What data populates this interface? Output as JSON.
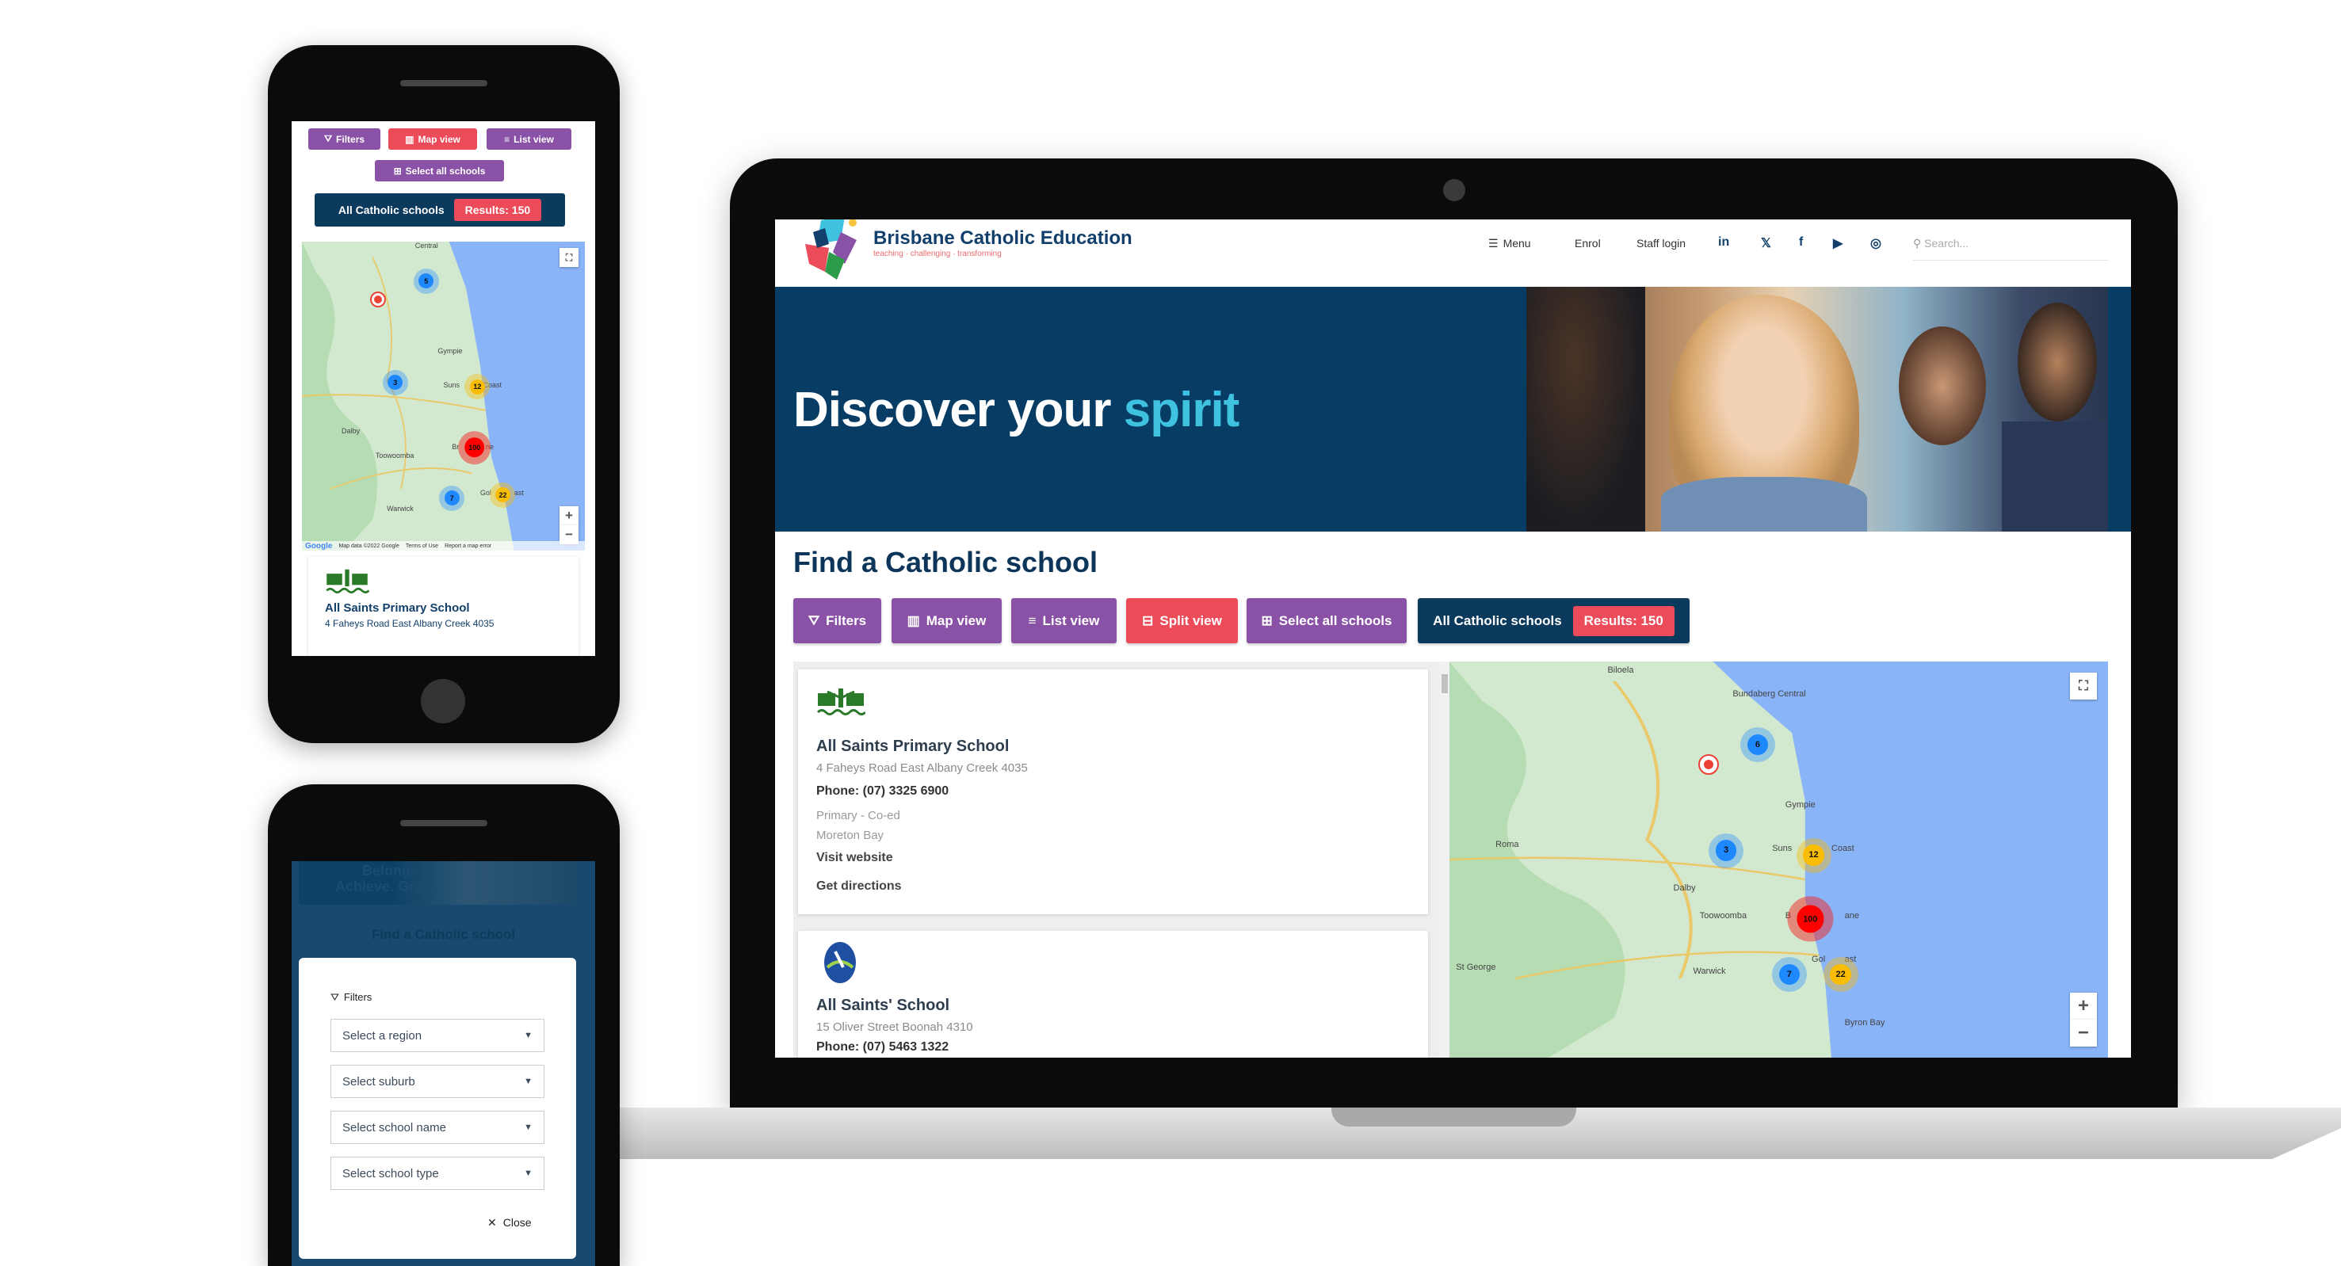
{
  "laptop": {
    "header": {
      "brand": "Brisbane Catholic Education",
      "tagline": "teaching · challenging · transforming",
      "nav": [
        {
          "label": "Menu",
          "icon": "hamburger-icon"
        },
        {
          "label": "Enrol"
        },
        {
          "label": "Staff login"
        }
      ],
      "social": [
        "in",
        "𝕏",
        "f",
        "▶",
        "◎"
      ],
      "social_icons": [
        "linkedin-icon",
        "twitter-icon",
        "facebook-icon",
        "youtube-icon",
        "instagram-icon"
      ],
      "search_placeholder": "Search..."
    },
    "hero": {
      "title_main": "Discover your ",
      "title_accent": "spirit"
    },
    "find_title": "Find a Catholic school",
    "toolbar": {
      "filters": "Filters",
      "map_view": "Map view",
      "list_view": "List view",
      "split_view": "Split view",
      "select_all": "Select all schools",
      "all_schools": "All Catholic schools",
      "results": "Results: 150"
    },
    "schools": [
      {
        "name": "All Saints Primary School",
        "address": "4 Faheys Road East  Albany Creek  4035",
        "phone": "Phone: (07) 3325 6900",
        "type": "Primary - Co-ed",
        "region": "Moreton Bay",
        "visit": "Visit website",
        "directions": "Get directions"
      },
      {
        "name": "All Saints' School",
        "address": "15 Oliver Street  Boonah  4310",
        "phone": "Phone: (07) 5463 1322"
      }
    ],
    "map": {
      "clusters": [
        "6",
        "3",
        "12",
        "100",
        "7",
        "22"
      ],
      "places": [
        "Biloela",
        "Bundaberg Central",
        "Gympie",
        "Roma",
        "Suns",
        "Coast",
        "Dalby",
        "Toowoomba",
        "Warwick",
        "Gol",
        "ast",
        "St George",
        "Byron Bay",
        "B",
        "ane"
      ],
      "zoom_in": "+",
      "zoom_out": "−"
    }
  },
  "phone1": {
    "toolbar": {
      "filters": "Filters",
      "map_view": "Map view",
      "list_view": "List view",
      "select_all": "Select all schools",
      "all_schools": "All Catholic schools",
      "results": "Results: 150"
    },
    "map": {
      "clusters": [
        "5",
        "3",
        "12",
        "100",
        "7",
        "22"
      ],
      "places": [
        "Central",
        "Gympie",
        "Suns",
        "Coast",
        "Dalby",
        "Toowoomba",
        "Warwick",
        "Gol",
        "ast",
        "Br",
        "ne"
      ],
      "attribution": "Map data ©2022 Google",
      "terms": "Terms of Use",
      "report": "Report a map error",
      "google": "Google",
      "zoom_in": "+",
      "zoom_out": "−"
    },
    "school": {
      "name": "All Saints Primary School",
      "address": "4 Faheys Road East  Albany Creek  4035"
    }
  },
  "phone2": {
    "hero_text_1": "Belong.",
    "hero_text_2": "Achieve. Grow.",
    "find_title": "Find a Catholic school",
    "filters_title": "Filters",
    "selects": [
      "Select a region",
      "Select suburb",
      "Select school name",
      "Select school type"
    ],
    "close": "Close"
  },
  "colors": {
    "purple": "#8a52a6",
    "red": "#ec4c5a",
    "navy": "#0b3a5c",
    "hero": "#073c64",
    "accent": "#3fc1e0"
  }
}
